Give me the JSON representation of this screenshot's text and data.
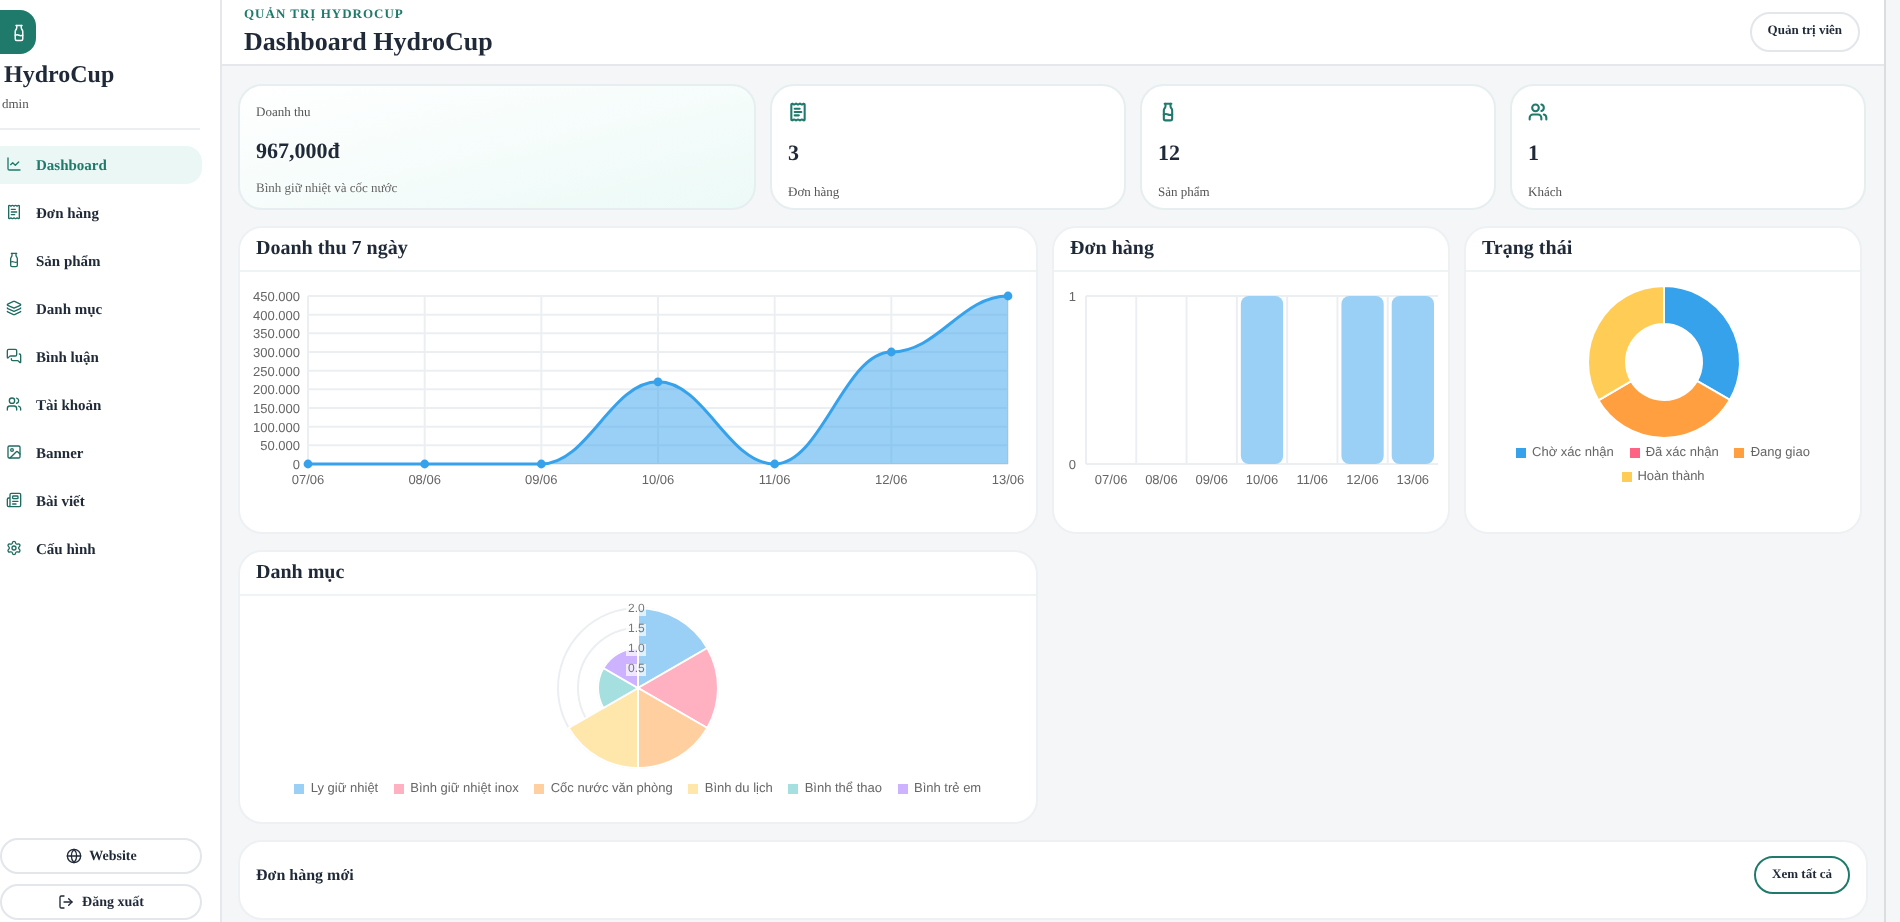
{
  "sidebar": {
    "brand": "HydroCup",
    "subtitle": "dmin",
    "items": [
      {
        "label": "Dashboard",
        "selected": true
      },
      {
        "label": "Đơn hàng",
        "selected": false
      },
      {
        "label": "Sản phẩm",
        "selected": false
      },
      {
        "label": "Danh mục",
        "selected": false
      },
      {
        "label": "Bình luận",
        "selected": false
      },
      {
        "label": "Tài khoản",
        "selected": false
      },
      {
        "label": "Banner",
        "selected": false
      },
      {
        "label": "Bài viết",
        "selected": false
      },
      {
        "label": "Cấu hình",
        "selected": false
      }
    ],
    "footer_buttons": [
      "Website",
      "Đăng xuất"
    ]
  },
  "header": {
    "eyebrow": "QUẢN TRỊ HYDROCUP",
    "title": "Dashboard HydroCup",
    "user_button": "Quản trị viên"
  },
  "stats": [
    {
      "kind": "highlight",
      "label": "Doanh thu",
      "value": "967,000đ",
      "note": "Bình giữ nhiệt và cốc nước"
    },
    {
      "kind": "icon",
      "value": "3",
      "label": "Đơn hàng"
    },
    {
      "kind": "icon",
      "value": "12",
      "label": "Sản phẩm"
    },
    {
      "kind": "icon",
      "value": "1",
      "label": "Khách"
    }
  ],
  "revenue_card": {
    "title": "Doanh thu 7 ngày",
    "chart_data": {
      "type": "area",
      "categories": [
        "07/06",
        "08/06",
        "09/06",
        "10/06",
        "11/06",
        "12/06",
        "13/06"
      ],
      "series": [
        {
          "color": "#36a2eb",
          "values": [
            0,
            0,
            0,
            220,
            0,
            300,
            450
          ]
        }
      ],
      "grid": true,
      "ylim": [
        0,
        450
      ],
      "yticks": [
        {
          "value": 0,
          "label": "0"
        },
        {
          "value": 50,
          "label": "50.000"
        },
        {
          "value": 100,
          "label": "100.000"
        },
        {
          "value": 150,
          "label": "150.000"
        },
        {
          "value": 200,
          "label": "200.000"
        },
        {
          "value": 250,
          "label": "250.000"
        },
        {
          "value": 300,
          "label": "300.000"
        },
        {
          "value": 350,
          "label": "350.000"
        },
        {
          "value": 400,
          "label": "400.000"
        },
        {
          "value": 450,
          "label": "450.000"
        }
      ]
    }
  },
  "orders_card": {
    "title": "Đơn hàng",
    "chart_data": {
      "type": "bar",
      "categories": [
        "07/06",
        "08/06",
        "09/06",
        "10/06",
        "11/06",
        "12/06",
        "13/06"
      ],
      "series": [
        {
          "color": "#9ad0f5",
          "values": [
            0,
            0,
            0,
            1,
            0,
            1,
            1
          ]
        }
      ],
      "grid": true,
      "ylim": [
        0,
        1
      ],
      "yticks": [
        0,
        1
      ]
    }
  },
  "status_card": {
    "title": "Trạng thái",
    "chart_data": {
      "type": "donut",
      "categories": [
        "Chờ xác nhận",
        "Đã xác nhận",
        "Đang giao",
        "Hoàn thành"
      ],
      "values": [
        33.3,
        0,
        33.3,
        33.4
      ],
      "colors": [
        "#36a2eb",
        "#ff6384",
        "#ff9f40",
        "#ffcd56"
      ],
      "legend": "bottom"
    }
  },
  "category_card": {
    "title": "Danh mục",
    "scale_labels": [
      "2.0",
      "1.5",
      "1.0",
      "0.5"
    ],
    "legend": [
      {
        "label": "Ly giữ nhiệt",
        "color": "#9ad0f5"
      },
      {
        "label": "Bình giữ nhiệt inox",
        "color": "#ffb1c1"
      },
      {
        "label": "Cốc nước văn phòng",
        "color": "#ffcf9f"
      },
      {
        "label": "Bình du lịch",
        "color": "#ffe6aa"
      },
      {
        "label": "Bình thể thao",
        "color": "#a5dfdf"
      },
      {
        "label": "Bình trẻ em",
        "color": "#ccb2ff"
      }
    ]
  },
  "recent_orders": {
    "title": "Đơn hàng mới",
    "button": "Xem tất cả"
  }
}
